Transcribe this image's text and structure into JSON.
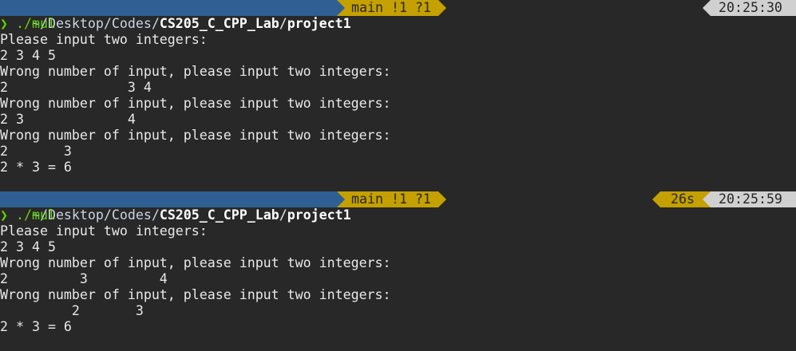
{
  "colors": {
    "background": "#282828",
    "path_segment": "#2f5f93",
    "git_segment": "#c4a000",
    "time_segment": "#d0d0d0",
    "prompt_chevron": "#5fd700",
    "command_text": "#5fd700",
    "output_text": "#e8e8e8"
  },
  "prompt": {
    "path_prefix": "~/Desktop/Codes/",
    "path_bold_dir": "CS205_C_CPP_Lab",
    "path_sep": "/",
    "path_last": "project1",
    "git_status": "main !1 ?1",
    "chevron_icon": "❯"
  },
  "session1": {
    "time": "20:25:30",
    "command": "./mul",
    "output": [
      "Please input two integers:",
      "2 3 4 5",
      "Wrong number of input, please input two integers:",
      "2               3 4",
      "Wrong number of input, please input two integers:",
      "2 3             4",
      "Wrong number of input, please input two integers:",
      "2       3",
      "2 * 3 = 6"
    ]
  },
  "session2": {
    "duration": "26s",
    "time": "20:25:59",
    "command": "./mul",
    "output": [
      "Please input two integers:",
      "2 3 4 5",
      "Wrong number of input, please input two integers:",
      "2         3         4",
      "Wrong number of input, please input two integers:",
      "         2       3",
      "2 * 3 = 6"
    ]
  }
}
